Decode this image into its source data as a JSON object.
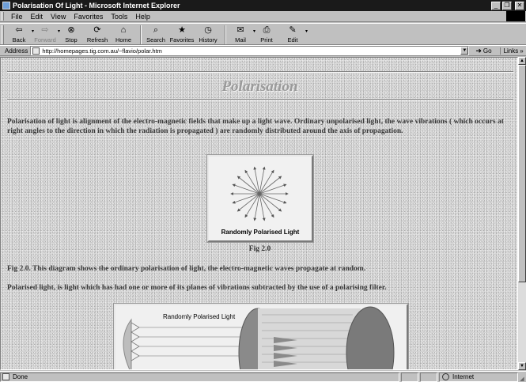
{
  "window": {
    "title": "Polarisation Of Light - Microsoft Internet Explorer",
    "minimize_glyph": "_",
    "maximize_glyph": "❐",
    "close_glyph": "✕"
  },
  "menu": [
    {
      "label": "File"
    },
    {
      "label": "Edit"
    },
    {
      "label": "View"
    },
    {
      "label": "Favorites"
    },
    {
      "label": "Tools"
    },
    {
      "label": "Help"
    }
  ],
  "toolbar": {
    "back": {
      "label": "Back",
      "icon": "back-arrow-icon",
      "glyph": "⇦"
    },
    "forward": {
      "label": "Forward",
      "icon": "forward-arrow-icon",
      "glyph": "⇨"
    },
    "stop": {
      "label": "Stop",
      "icon": "stop-icon",
      "glyph": "⊗"
    },
    "refresh": {
      "label": "Refresh",
      "icon": "refresh-icon",
      "glyph": "⟳"
    },
    "home": {
      "label": "Home",
      "icon": "home-icon",
      "glyph": "⌂"
    },
    "search": {
      "label": "Search",
      "icon": "search-icon",
      "glyph": "⌕"
    },
    "favorites": {
      "label": "Favorites",
      "icon": "favorites-icon",
      "glyph": "★"
    },
    "history": {
      "label": "History",
      "icon": "history-icon",
      "glyph": "◷"
    },
    "mail": {
      "label": "Mail",
      "icon": "mail-icon",
      "glyph": "✉"
    },
    "print": {
      "label": "Print",
      "icon": "print-icon",
      "glyph": "⎙"
    },
    "edit": {
      "label": "Edit",
      "icon": "edit-icon",
      "glyph": "✎"
    }
  },
  "address": {
    "label": "Address",
    "url": "http://homepages.tig.com.au/~flavio/polar.htm",
    "go_label": "Go",
    "links_label": "Links",
    "links_glyph": "»"
  },
  "page": {
    "title": "Polarisation",
    "intro": "Polarisation of light is alignment of the electro-magnetic fields that make up a light wave. Ordinary unpolarised light, the wave vibrations ( which occurs at right angles to the direction in which the radiation is propagated ) are randomly distributed around the axis of propagation.",
    "figure1_caption": "Randomly Polarised Light",
    "figure1_label": "Fig 2.0",
    "figure1_description": "Fig 2.0. This diagram shows the ordinary polarisation of light, the electro-magnetic waves propagate at random.",
    "polarised_text": "Polarised light, is light which has had one or more of its planes of vibrations subtracted by the use of a polarising filter.",
    "figure2_caption": "Randomly Polarised Light"
  },
  "status": {
    "text": "Done",
    "zone": "Internet"
  },
  "colors": {
    "title_bar": "#1a1a1a",
    "chrome": "#c0c0c0",
    "page_background": "#d4d4d4",
    "heading": "#9a9a9a"
  }
}
